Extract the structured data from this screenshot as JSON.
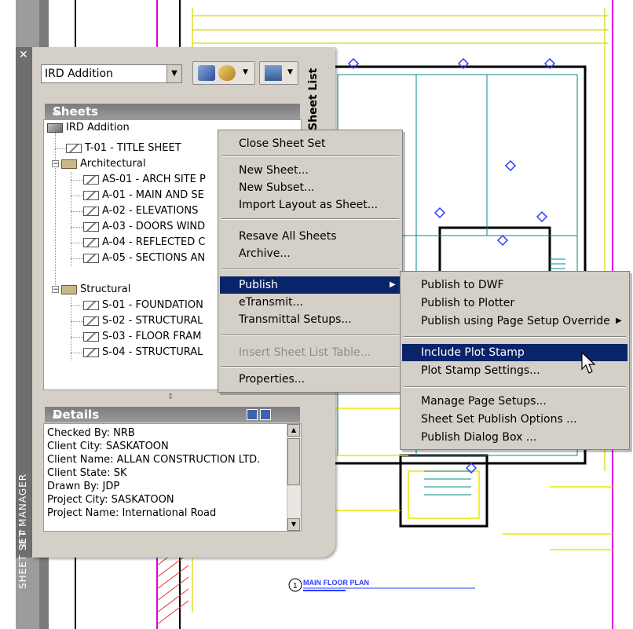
{
  "palette": {
    "title": "SHEET SET MANAGER",
    "sheet_list_tab": "Sheet List",
    "sheet_set_dropdown": {
      "value": "IRD Addition"
    }
  },
  "sheets": {
    "title": "Sheets",
    "tree": {
      "root": "IRD Addition",
      "items": [
        {
          "label": "T-01 - TITLE SHEET"
        },
        {
          "label": "Architectural",
          "children": [
            "AS-01 - ARCH SITE P",
            "A-01 - MAIN AND SE",
            "A-02 - ELEVATIONS",
            "A-03 - DOORS WIND",
            "A-04 - REFLECTED C",
            "A-05 - SECTIONS AN"
          ]
        },
        {
          "label": "Structural",
          "children": [
            "S-01 - FOUNDATION",
            "S-02 - STRUCTURAL",
            "S-03 - FLOOR FRAM",
            "S-04 - STRUCTURAL"
          ]
        }
      ]
    }
  },
  "details": {
    "title": "Details",
    "lines": [
      "Checked By: NRB",
      "Client City: SASKATOON",
      "Client Name: ALLAN CONSTRUCTION LTD.",
      "Client State: SK",
      "Drawn By: JDP",
      "Project City: SASKATOON",
      "Project Name: International Road"
    ]
  },
  "context_menu": {
    "items": [
      {
        "label": "Close Sheet Set"
      },
      {
        "label": "New Sheet..."
      },
      {
        "label": "New Subset..."
      },
      {
        "label": "Import Layout as Sheet..."
      },
      {
        "label": "Resave All Sheets"
      },
      {
        "label": "Archive..."
      },
      {
        "label": "Publish",
        "highlighted": true,
        "submenu": true
      },
      {
        "label": "eTransmit..."
      },
      {
        "label": "Transmittal Setups..."
      },
      {
        "label": "Insert Sheet List Table...",
        "disabled": true
      },
      {
        "label": "Properties..."
      }
    ]
  },
  "publish_submenu": {
    "items": [
      {
        "label": "Publish to DWF"
      },
      {
        "label": "Publish to Plotter"
      },
      {
        "label": "Publish using Page Setup Override",
        "submenu": true
      },
      {
        "label": "Include Plot Stamp",
        "highlighted": true
      },
      {
        "label": "Plot Stamp Settings..."
      },
      {
        "label": "Manage Page Setups..."
      },
      {
        "label": "Sheet Set Publish Options ..."
      },
      {
        "label": "Publish Dialog Box ..."
      }
    ]
  },
  "drawing": {
    "plan_title": "MAIN FLOOR PLAN",
    "plan_number": "1"
  },
  "colors": {
    "menu_highlight": "#0a246a",
    "cad_yellow": "#e8e800",
    "cad_magenta": "#e000e0",
    "cad_blue": "#2a3cff"
  }
}
